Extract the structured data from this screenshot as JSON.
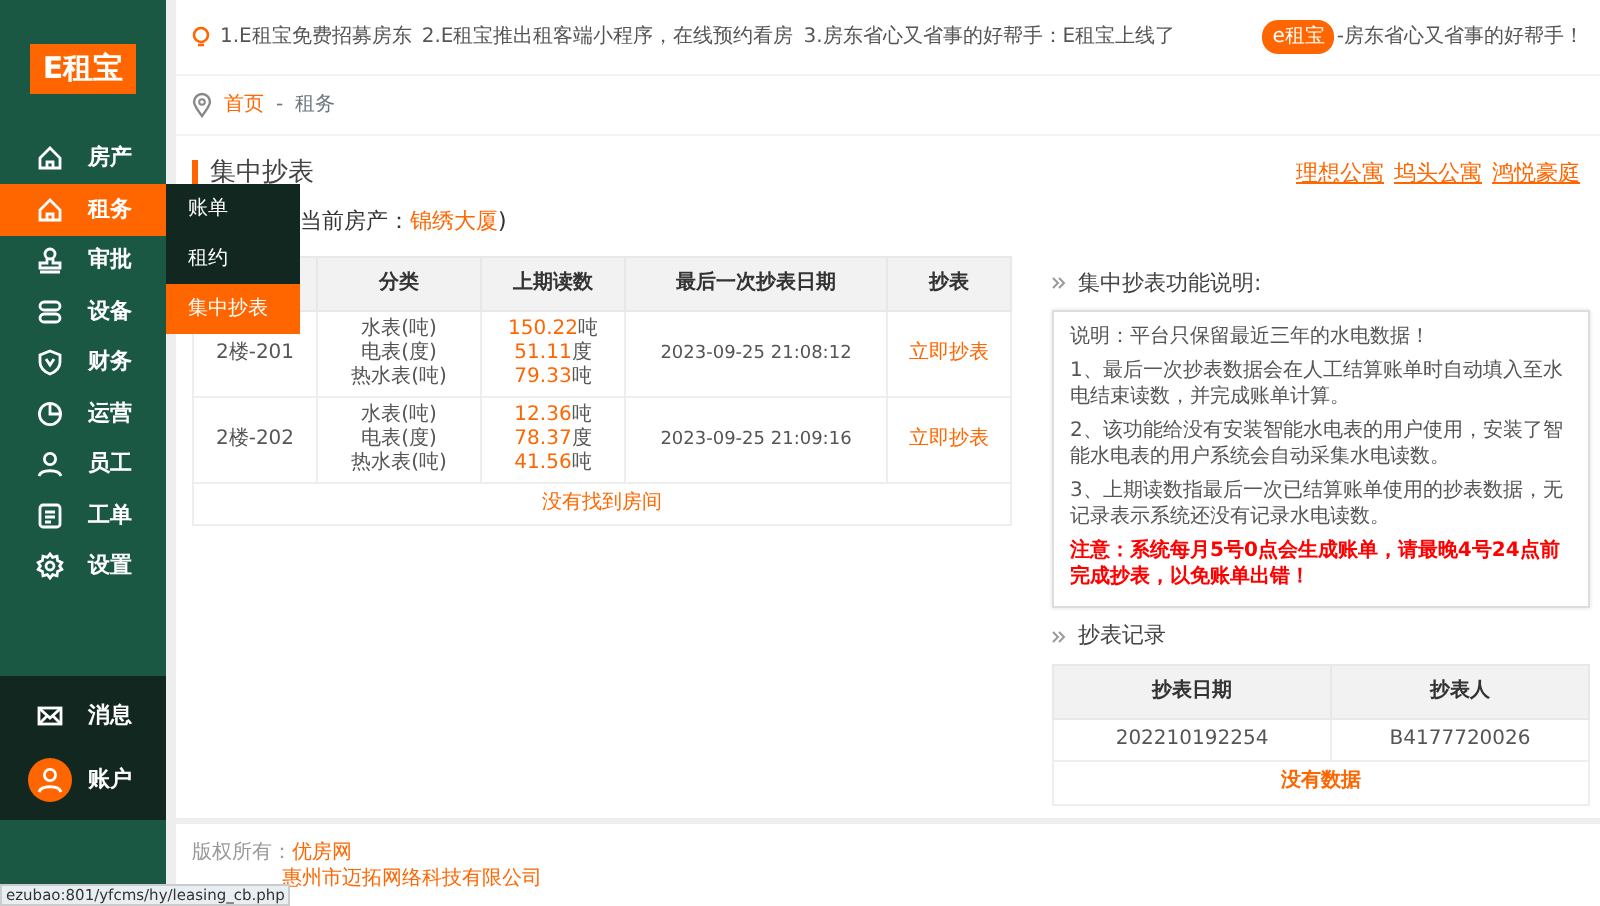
{
  "sidebar": {
    "logo": "E租宝",
    "items": [
      {
        "label": "房产",
        "selected": false
      },
      {
        "label": "租务",
        "selected": true
      },
      {
        "label": "审批",
        "selected": false
      },
      {
        "label": "设备",
        "selected": false
      },
      {
        "label": "财务",
        "selected": false
      },
      {
        "label": "运营",
        "selected": false
      },
      {
        "label": "员工",
        "selected": false
      },
      {
        "label": "工单",
        "selected": false
      },
      {
        "label": "设置",
        "selected": false
      }
    ],
    "bottom_items": [
      {
        "label": "消息",
        "kind": "icon"
      },
      {
        "label": "账户",
        "kind": "avatar"
      }
    ]
  },
  "submenu": {
    "items": [
      {
        "label": "账单",
        "selected": false
      },
      {
        "label": "租约",
        "selected": false
      },
      {
        "label": "集中抄表",
        "selected": true
      }
    ]
  },
  "notice": {
    "items": [
      "1.E租宝免费招募房东",
      "2.E租宝推出租客端小程序，在线预约看房",
      "3.房东省心又省事的好帮手：E租宝上线了"
    ],
    "badge": "e租宝",
    "slogan": "-房东省心又省事的好帮手！"
  },
  "breadcrumb": [
    "首页",
    "-",
    "租务"
  ],
  "page_title": "集中抄表",
  "current_property": {
    "label": "当前房产：",
    "value": "锦绣大厦",
    "tail": ")"
  },
  "property_links": [
    "理想公寓",
    "坞头公寓",
    "鸿悦豪庭"
  ],
  "table": {
    "columns": [
      "分类",
      "上期读数",
      "最后一次抄表日期",
      "抄表"
    ],
    "rows": [
      {
        "room": "2楼-201",
        "meters": [
          {
            "type": "水表(吨)",
            "reading": "150.22",
            "unit": "吨"
          },
          {
            "type": "电表(度)",
            "reading": "51.11",
            "unit": "度"
          },
          {
            "type": "热水表(吨)",
            "reading": "79.33",
            "unit": "吨"
          }
        ],
        "last_date": "2023-09-25 21:08:12",
        "action": "立即抄表"
      },
      {
        "room": "2楼-202",
        "meters": [
          {
            "type": "水表(吨)",
            "reading": "12.36",
            "unit": "吨"
          },
          {
            "type": "电表(度)",
            "reading": "78.37",
            "unit": "度"
          },
          {
            "type": "热水表(吨)",
            "reading": "41.56",
            "unit": "吨"
          }
        ],
        "last_date": "2023-09-25 21:09:16",
        "action": "立即抄表"
      }
    ],
    "footer": "没有找到房间"
  },
  "info": {
    "title": "集中抄表功能说明:",
    "intro": "说明：平台只保留最近三年的水电数据！",
    "points": [
      "1、最后一次抄表数据会在人工结算账单时自动填入至水电结束读数，并完成账单计算。",
      "2、该功能给没有安装智能水电表的用户使用，安装了智能水电表的用户系统会自动采集水电读数。",
      "3、上期读数指最后一次已结算账单使用的抄表数据，无记录表示系统还没有记录水电读数。"
    ],
    "warning": "注意：系统每月5号0点会生成账单，请最晚4号24点前完成抄表，以免账单出错！"
  },
  "records": {
    "title": "抄表记录",
    "columns": [
      "抄表日期",
      "抄表人"
    ],
    "rows": [
      [
        "202210192254",
        "B4177720026"
      ]
    ],
    "empty": "没有数据"
  },
  "footer": {
    "copyright_label": "版权所有：",
    "copyright": "优房网",
    "support": "惠州市迈拓网络科技有限公司"
  },
  "status_url": "ezubao:801/yfcms/hy/leasing_cb.php"
}
